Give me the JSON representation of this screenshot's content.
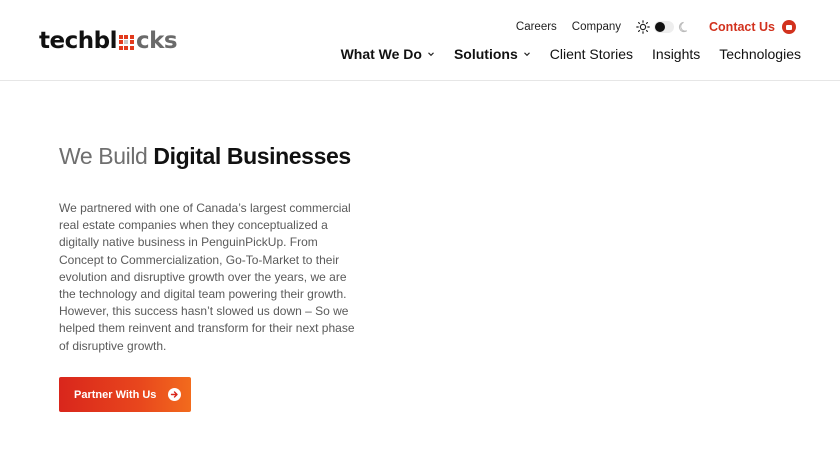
{
  "header": {
    "logo": {
      "part1": "techbl",
      "part2": "cks"
    },
    "utility_links": [
      "Careers",
      "Company"
    ],
    "contact_label": "Contact Us",
    "main_nav": [
      {
        "label": "What We Do",
        "dropdown": true
      },
      {
        "label": "Solutions",
        "dropdown": true
      },
      {
        "label": "Client Stories",
        "dropdown": false
      },
      {
        "label": "Insights",
        "dropdown": false
      },
      {
        "label": "Technologies",
        "dropdown": false
      }
    ],
    "theme": "light"
  },
  "hero": {
    "title_light": "We Build",
    "title_bold": "Digital Businesses",
    "body": "We partnered with one of Canada’s largest commercial real estate companies when they conceptualized a digitally native business in PenguinPickUp. From Concept to Commercialization, Go-To-Market to their evolution and disruptive growth over the years, we are the technology and digital team powering their growth. However, this success hasn’t slowed us down – So we helped them reinvent and transform for their next phase of disruptive growth.",
    "cta_label": "Partner With Us"
  },
  "colors": {
    "brand_red": "#d2321e",
    "cta_gradient_start": "#d9261c",
    "cta_gradient_end": "#f26b1d",
    "text_dark": "#111111",
    "text_muted": "#5a5a5a"
  },
  "icons": [
    "sun-icon",
    "theme-toggle-switch",
    "moon-icon",
    "contact-badge-icon",
    "chevron-down-icon",
    "arrow-right-circle-icon"
  ]
}
